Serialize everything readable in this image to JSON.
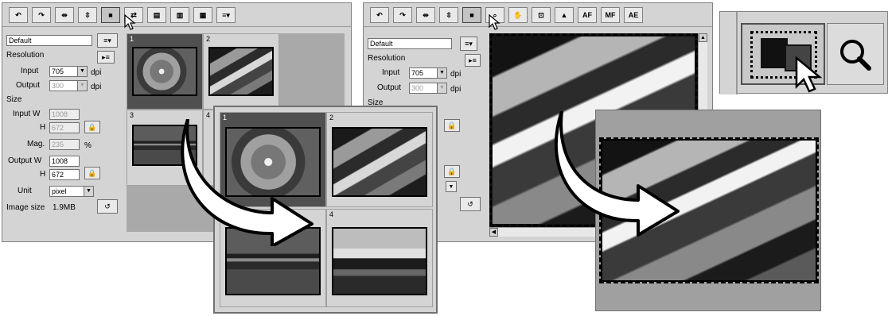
{
  "left_window": {
    "toolbar": [
      {
        "icon": "rotate-left-icon",
        "glyph": "↶"
      },
      {
        "icon": "rotate-right-icon",
        "glyph": "↷"
      },
      {
        "icon": "flip-horizontal-icon",
        "glyph": "⇹"
      },
      {
        "icon": "flip-vertical-icon",
        "glyph": "⇳"
      },
      {
        "icon": "select-frame-icon",
        "glyph": "■"
      },
      {
        "icon": "swap-frames-icon",
        "glyph": "⇄"
      },
      {
        "icon": "index-frame-icon",
        "glyph": "▤"
      },
      {
        "icon": "index-frames-icon",
        "glyph": "▥"
      },
      {
        "icon": "index-all-icon",
        "glyph": "▦"
      },
      {
        "icon": "menu-dropdown-icon",
        "glyph": "≡▾"
      }
    ],
    "settings_name": "Default",
    "resolution_label": "Resolution",
    "input_label": "Input",
    "input_value": "705",
    "output_label": "Output",
    "output_value": "300",
    "unit_dpi": "dpi",
    "size_label": "Size",
    "input_w_label": "Input W",
    "input_w_value": "1008",
    "h_label": "H",
    "input_h_value": "672",
    "mag_label": "Mag.",
    "mag_value": "235",
    "percent": "%",
    "output_w_label": "Output W",
    "output_w_value": "1008",
    "output_h_value": "672",
    "unit_label": "Unit",
    "unit_value": "pixel",
    "image_size_label": "Image size",
    "image_size_value": "1.9MB",
    "frames": [
      "1",
      "2",
      "3",
      "4"
    ]
  },
  "index_popup": {
    "frames": [
      "1",
      "2",
      "3",
      "4"
    ]
  },
  "right_window": {
    "toolbar": [
      {
        "icon": "rotate-left-icon",
        "glyph": "↶"
      },
      {
        "icon": "rotate-right-icon",
        "glyph": "↷"
      },
      {
        "icon": "flip-horizontal-icon",
        "glyph": "⇹"
      },
      {
        "icon": "flip-vertical-icon",
        "glyph": "⇳"
      },
      {
        "icon": "select-frame-icon",
        "glyph": "■"
      },
      {
        "icon": "zoom-icon",
        "glyph": "⌕"
      },
      {
        "icon": "hand-icon",
        "glyph": "✋"
      },
      {
        "icon": "crop-icon",
        "glyph": "⊡"
      },
      {
        "icon": "lock-icon",
        "glyph": "▲"
      },
      {
        "icon": "auto-focus-icon",
        "glyph": "AF"
      },
      {
        "icon": "manual-focus-icon",
        "glyph": "MF"
      },
      {
        "icon": "auto-exposure-icon",
        "glyph": "AE"
      }
    ],
    "settings_name": "Default",
    "resolution_label": "Resolution",
    "input_label": "Input",
    "input_value": "705",
    "output_label": "Output",
    "output_value": "300",
    "unit_dpi": "dpi",
    "size_label": "Size"
  },
  "zoom_inset": {
    "icons": [
      "select-frame-icon",
      "zoom-icon"
    ]
  },
  "colors": {
    "window_bg": "#d4d4d4",
    "selected_frame": "#505050",
    "arrow_fill": "#ffffff",
    "arrow_stroke": "#000000"
  }
}
